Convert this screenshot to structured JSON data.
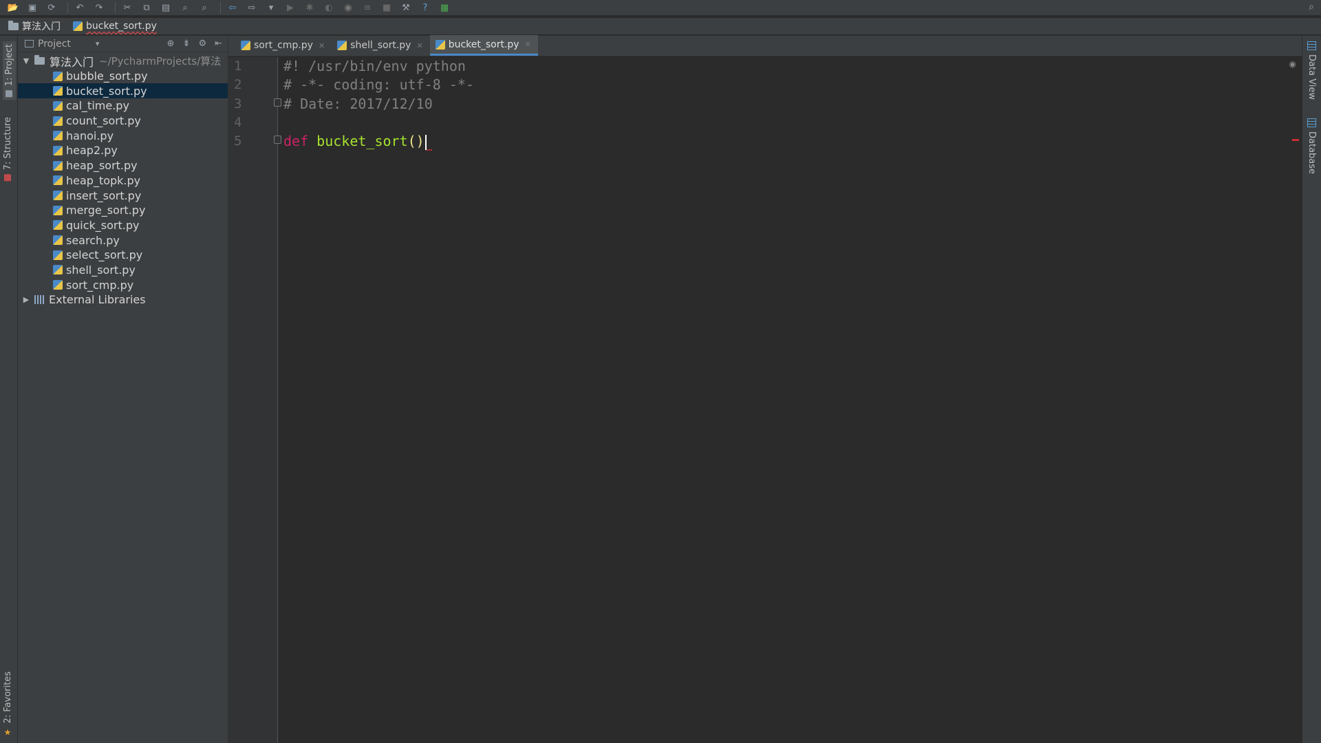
{
  "window": {
    "toolbar_icons": [
      "open-folder-icon",
      "save-icon",
      "sync-icon",
      "undo-icon",
      "redo-icon",
      "cut-icon",
      "copy-icon",
      "paste-icon",
      "find-icon",
      "replace-icon",
      "back-icon",
      "forward-icon",
      "run-config-dropdown-icon",
      "run-icon",
      "debug-icon",
      "coverage-icon",
      "profile-icon",
      "concurrency-icon",
      "stop-icon",
      "settings-icon",
      "help-icon",
      "vcs-icon",
      "search-everywhere-icon"
    ]
  },
  "breadcrumb": {
    "project": "算法入门",
    "file": "bucket_sort.py"
  },
  "left_stripe": {
    "project_tab": "1: Project",
    "structure_tab": "7: Structure",
    "favorites_tab": "2: Favorites"
  },
  "project_panel": {
    "title": "Project",
    "root_name": "算法入门",
    "root_path": "~/PycharmProjects/算法",
    "files": [
      {
        "name": "bubble_sort.py"
      },
      {
        "name": "bucket_sort.py",
        "selected": true
      },
      {
        "name": "cal_time.py"
      },
      {
        "name": "count_sort.py"
      },
      {
        "name": "hanoi.py"
      },
      {
        "name": "heap2.py"
      },
      {
        "name": "heap_sort.py"
      },
      {
        "name": "heap_topk.py"
      },
      {
        "name": "insert_sort.py"
      },
      {
        "name": "merge_sort.py"
      },
      {
        "name": "quick_sort.py"
      },
      {
        "name": "search.py"
      },
      {
        "name": "select_sort.py"
      },
      {
        "name": "shell_sort.py"
      },
      {
        "name": "sort_cmp.py"
      }
    ],
    "external_libraries": "External Libraries"
  },
  "tabs": [
    {
      "label": "sort_cmp.py",
      "active": false
    },
    {
      "label": "shell_sort.py",
      "active": false
    },
    {
      "label": "bucket_sort.py",
      "active": true
    }
  ],
  "editor": {
    "line_numbers": [
      "1",
      "2",
      "3",
      "4",
      "5"
    ],
    "lines": {
      "l1": "#! /usr/bin/env python",
      "l2": "# -*- coding: utf-8 -*-",
      "l3": "# Date: 2017/12/10",
      "l4": "",
      "l5_keyword": "def",
      "l5_name": " bucket_sort",
      "l5_parens": "()"
    }
  },
  "right_stripe": {
    "data_view_tab": "Data View",
    "database_tab": "Database"
  },
  "colors": {
    "background": "#2b2b2b",
    "panel": "#3c3f41",
    "selection": "#0d293e",
    "keyword": "#cc2266",
    "function": "#a6e22e",
    "comment": "#808080",
    "accent": "#4a88c7"
  }
}
